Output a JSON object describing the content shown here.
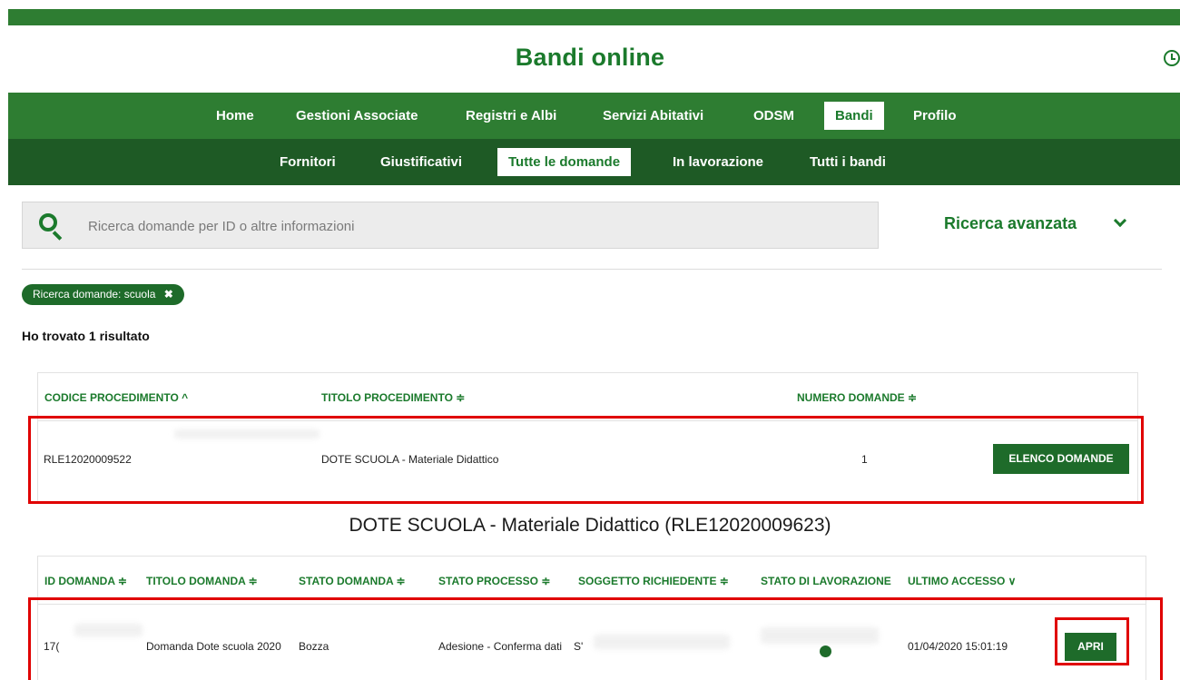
{
  "header": {
    "title": "Bandi online",
    "clock_icon": "clock-icon"
  },
  "nav_main": {
    "items": [
      "Home",
      "Gestioni Associate",
      "Registri e Albi",
      "Servizi Abitativi",
      "ODSM",
      "Bandi",
      "Profilo"
    ],
    "active": "Bandi"
  },
  "nav_sub": {
    "items": [
      "Fornitori",
      "Giustificativi",
      "Tutte le domande",
      "In lavorazione",
      "Tutti i bandi"
    ],
    "active": "Tutte le domande"
  },
  "search": {
    "placeholder": "Ricerca domande per ID o altre informazioni",
    "value": "",
    "advanced_label": "Ricerca avanzata"
  },
  "filter_chip": {
    "label": "Ricerca domande: scuola",
    "close_glyph": "✖"
  },
  "result_count": "Ho trovato 1 risultato",
  "procedures_table": {
    "headers": [
      "CODICE PROCEDIMENTO ^",
      "TITOLO PROCEDIMENTO ≑",
      "NUMERO DOMANDE ≑"
    ],
    "rows": [
      {
        "codice": "RLE12020009522",
        "titolo": "DOTE SCUOLA - Materiale Didattico",
        "numero": "1",
        "action": "ELENCO DOMANDE"
      }
    ]
  },
  "section_title": "DOTE SCUOLA - Materiale Didattico (RLE12020009623)",
  "applications_table": {
    "headers": [
      "ID DOMANDA ≑",
      "TITOLO DOMANDA ≑",
      "STATO DOMANDA ≑",
      "STATO PROCESSO ≑",
      "SOGGETTO RICHIEDENTE ≑",
      "STATO DI LAVORAZIONE",
      "ULTIMO ACCESSO ∨"
    ],
    "rows": [
      {
        "id": "17(",
        "titolo": "Domanda Dote scuola 2020",
        "stato_domanda": "Bozza",
        "stato_processo": "Adesione - Conferma dati",
        "soggetto": "S'",
        "ultimo_accesso": "01/04/2020 15:01:19",
        "action": "APRI"
      }
    ]
  },
  "colors": {
    "primary_green": "#2e7d32",
    "dark_green": "#1e5a25",
    "title_green": "#1b7a2c",
    "highlight_red": "#e00000"
  }
}
